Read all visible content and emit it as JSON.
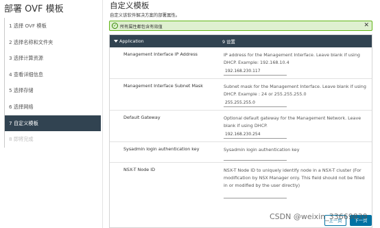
{
  "wizard": {
    "title": "部署 OVF 模板",
    "steps": [
      {
        "label": "1  选择 OVF 模板",
        "state": "normal"
      },
      {
        "label": "2  选择名称和文件夹",
        "state": "normal"
      },
      {
        "label": "3  选择计算资源",
        "state": "normal"
      },
      {
        "label": "4  查看详细信息",
        "state": "normal"
      },
      {
        "label": "5  选择存储",
        "state": "normal"
      },
      {
        "label": "6  选择网络",
        "state": "normal"
      },
      {
        "label": "7  自定义模板",
        "state": "active"
      },
      {
        "label": "8  即将完成",
        "state": "disabled"
      }
    ]
  },
  "main": {
    "title": "自定义模板",
    "subtitle": "自定义该软件解决方案的部署属性。",
    "alert": {
      "text": "所有属性都包含有效值",
      "icon": "check-circle-icon",
      "close": "✕"
    },
    "section": {
      "name": "Application",
      "count": "9 设置"
    },
    "properties": [
      {
        "label": "Management Interface IP Address",
        "desc": "IP address for the Management Interface. Leave blank if using DHCP. Example: 192.168.10.4",
        "value": "192.168.230.117"
      },
      {
        "label": "Management Interface Subnet Mask",
        "desc": "Subnet mask for the Management Interface. Leave blank if using DHCP. Example : 24 or 255.255.255.0",
        "value": "255.255.255.0"
      },
      {
        "label": "Default Gateway",
        "desc": "Optional default gateway for the Management Network. Leave blank if using DHCP.",
        "value": "192.168.230.254"
      },
      {
        "label": "Sysadmin login authentication key",
        "desc": "Sysadmin login authentication key",
        "value": ""
      },
      {
        "label": "NSX-T Node ID",
        "desc": "NSX-T Node ID to uniquely identify node in a NSX-T cluster (For modification by NSX Manager only. This field should not be filled in or modified by the user directly)",
        "value": ""
      }
    ]
  },
  "footer": {
    "back_label": "上一页",
    "next_label": "下一页"
  },
  "watermark": "CSDN @weixin_33669839",
  "colors": {
    "active_step": "#314351",
    "section_header": "#314351",
    "alert_bg": "#dff0d0",
    "alert_border": "#60b515",
    "primary": "#0072a3"
  }
}
